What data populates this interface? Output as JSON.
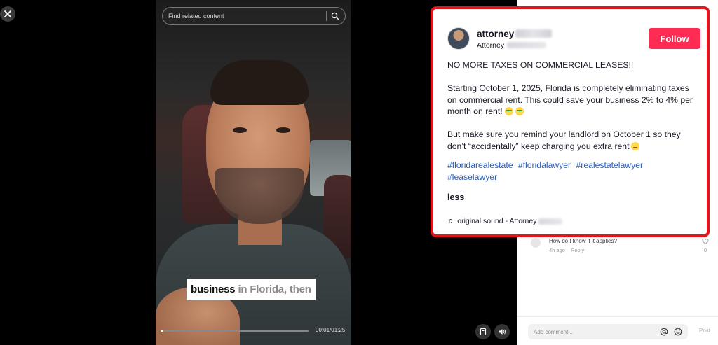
{
  "search": {
    "placeholder": "Find related content"
  },
  "video": {
    "caption_highlight": "business",
    "caption_rest": "in Florida, then",
    "time": "00:01/01:25",
    "progress_fraction": 0.01
  },
  "post": {
    "username": "attorney",
    "subtitle": "Attorney",
    "follow_label": "Follow",
    "headline": "NO MORE TAXES ON COMMERCIAL LEASES!!",
    "paragraph1": "Starting October 1, 2025, Florida is completely eliminating taxes on commercial rent. This could save your business 2% to 4% per month on rent!",
    "paragraph2": "But make sure you remind your landlord on October 1 so they don’t “accidentally” keep charging you extra rent",
    "hashtags": [
      "#floridarealestate",
      "#floridalawyer",
      "#realestatelawyer",
      "#leaselawyer"
    ],
    "less_label": "less",
    "sound_label": "original sound - Attorney"
  },
  "comments": [
    {
      "text": "How do I know if it applies?",
      "time": "4h ago",
      "reply_label": "Reply",
      "likes": "0"
    }
  ],
  "composer": {
    "placeholder": "Add comment...",
    "post_label": "Post"
  },
  "colors": {
    "follow": "#fe2c55",
    "highlight_border": "#e3151a",
    "hashtag": "#2b5db9"
  }
}
